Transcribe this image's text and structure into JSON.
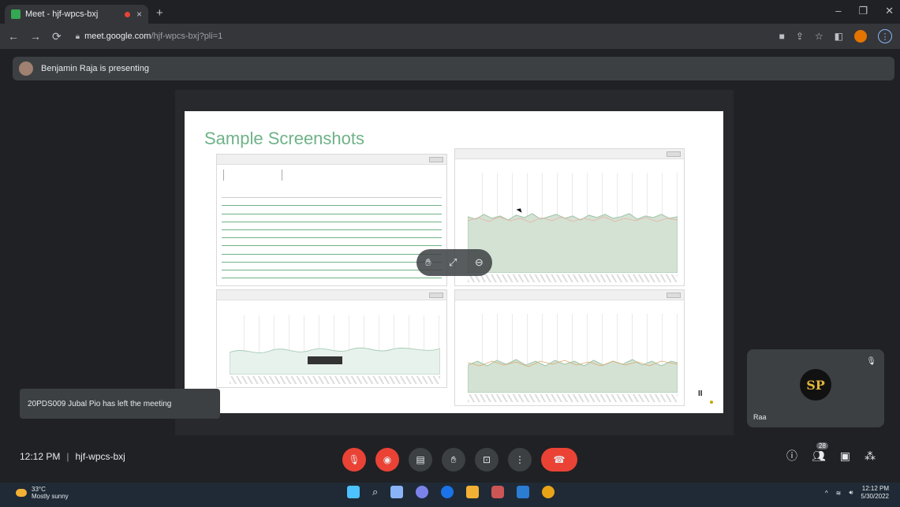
{
  "browser": {
    "tab_title": "Meet - hjf-wpcs-bxj",
    "tab_close": "×",
    "new_tab": "+",
    "window_controls": [
      "‒",
      "❐",
      "✕"
    ],
    "url_host": "meet.google.com",
    "url_path": "/hjf-wpcs-bxj?pli=1",
    "nav": [
      "←",
      "→",
      "⟳"
    ]
  },
  "meet": {
    "presenting_text": "Benjamin Raja is presenting",
    "slide_title": "Sample Screenshots",
    "toast_text": "20PDS009 Jubal Pio has left the meeting",
    "participant_name": "Raa",
    "participant_initials": "SP",
    "time": "12:12 PM",
    "separator": "|",
    "meeting_code": "hjf-wpcs-bxj",
    "people_count": "28",
    "pause_glyph": "II"
  },
  "taskbar": {
    "temperature": "33°C",
    "weather_text": "Mostly sunny",
    "clock_time": "12:12 PM",
    "clock_date": "5/30/2022"
  },
  "colors": {
    "accent": "#6fb288",
    "danger": "#ea4335",
    "meet_bg": "#202124"
  }
}
